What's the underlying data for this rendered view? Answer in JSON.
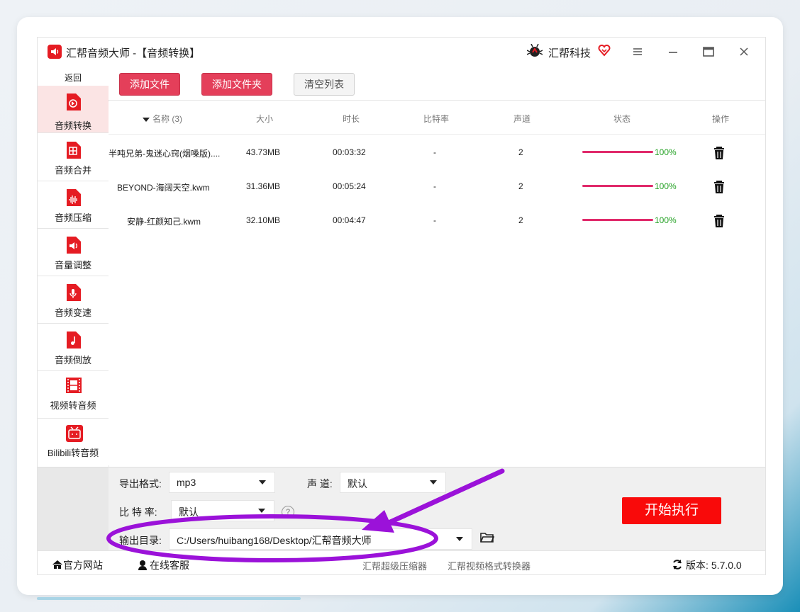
{
  "window": {
    "title": "汇帮音频大师  -【音频转换】",
    "brand": "汇帮科技"
  },
  "sidebar": {
    "back": "返回",
    "items": [
      {
        "label": "音频转换",
        "icon": "audio-convert-icon",
        "active": true
      },
      {
        "label": "音频合并",
        "icon": "audio-merge-icon"
      },
      {
        "label": "音频压缩",
        "icon": "audio-compress-icon"
      },
      {
        "label": "音量调整",
        "icon": "volume-icon"
      },
      {
        "label": "音频变速",
        "icon": "mic-icon"
      },
      {
        "label": "音频倒放",
        "icon": "music-note-icon"
      },
      {
        "label": "视频转音频",
        "icon": "film-icon"
      },
      {
        "label": "Bilibili转音频",
        "icon": "bilibili-tv-icon"
      }
    ]
  },
  "toolbar": {
    "add_file": "添加文件",
    "add_folder": "添加文件夹",
    "clear_list": "清空列表"
  },
  "table": {
    "headers": {
      "name": "名称 (3)",
      "size": "大小",
      "duration": "时长",
      "bitrate": "比特率",
      "channels": "声道",
      "status": "状态",
      "actions": "操作"
    },
    "rows": [
      {
        "name": "半吨兄弟-鬼迷心窍(烟嗓版)....",
        "size": "43.73MB",
        "duration": "00:03:32",
        "bitrate": "-",
        "channels": "2",
        "progress": "100%"
      },
      {
        "name": "BEYOND-海阔天空.kwm",
        "size": "31.36MB",
        "duration": "00:05:24",
        "bitrate": "-",
        "channels": "2",
        "progress": "100%"
      },
      {
        "name": "安静-红颜知己.kwm",
        "size": "32.10MB",
        "duration": "00:04:47",
        "bitrate": "-",
        "channels": "2",
        "progress": "100%"
      }
    ]
  },
  "settings": {
    "format_label": "导出格式:",
    "format_value": "mp3",
    "channel_label": "声 道:",
    "channel_value": "默认",
    "bitrate_label": "比 特 率:",
    "bitrate_value": "默认",
    "help": "?",
    "output_label": "输出目录:",
    "output_value": "C:/Users/huibang168/Desktop/汇帮音频大师",
    "start": "开始执行"
  },
  "footer": {
    "website": "官方网站",
    "support": "在线客服",
    "link1": "汇帮超级压缩器",
    "link2": "汇帮视频格式转换器",
    "version_label": "版本:",
    "version": "5.7.0.0"
  },
  "colors": {
    "accent_red": "#e43f5a",
    "start_red": "#f90a0a",
    "progress": "#e02a6b",
    "percent_green": "#22a022",
    "annotation_purple": "#9b12d9"
  }
}
